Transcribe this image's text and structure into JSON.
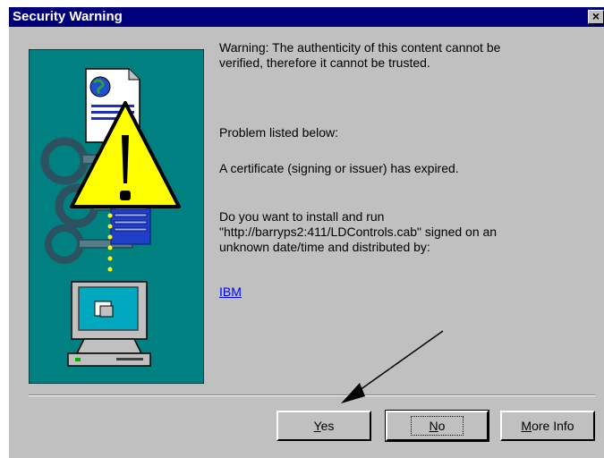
{
  "window": {
    "title": "Security Warning",
    "close_glyph": "×"
  },
  "message": {
    "warning_line1": "Warning: The authenticity of this content cannot be",
    "warning_line2": "verified, therefore it cannot be trusted.",
    "problem_heading": "Problem listed below:",
    "problem_detail": "A certificate (signing or issuer) has expired.",
    "question_line1": "Do you want to install and run",
    "question_line2": "\"http://barryps2:411/LDControls.cab\" signed on an",
    "question_line3": "unknown date/time and distributed by:",
    "publisher_link": "IBM"
  },
  "buttons": {
    "yes_mnemonic": "Y",
    "yes_rest": "es",
    "no_mnemonic": "N",
    "no_rest": "o",
    "more_mnemonic": "M",
    "more_rest": "ore Info"
  },
  "colors": {
    "title_bar": "#00007b",
    "dialog_bg": "#c0c0c0",
    "art_bg": "#008080",
    "link": "#0000ff"
  },
  "icons": [
    "warning-triangle-icon",
    "certificate-document-icon",
    "keys-icon",
    "computer-icon",
    "close-icon",
    "annotation-arrow"
  ]
}
